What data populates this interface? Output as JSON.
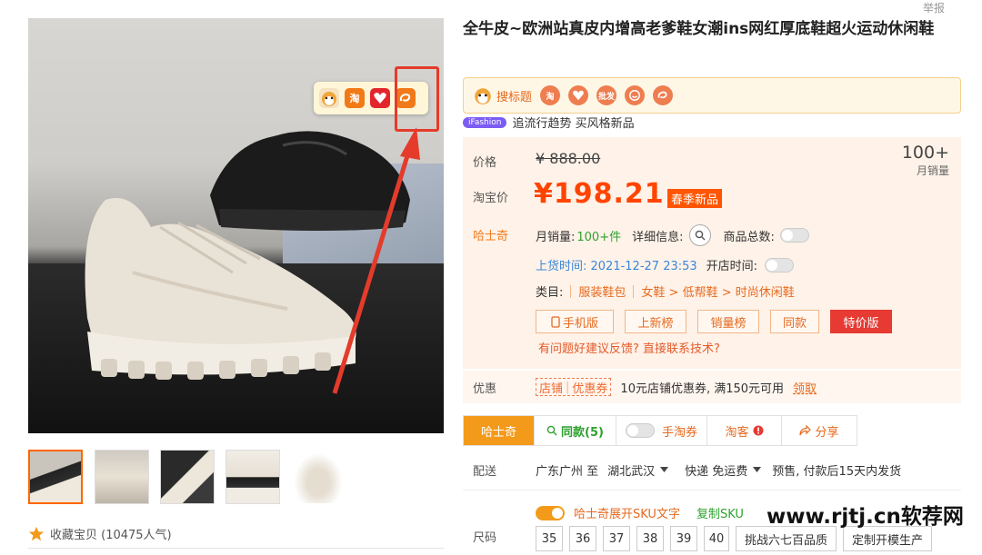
{
  "page_top_text": "举报",
  "product": {
    "title": "全牛皮~欧洲站真皮内增高老爹鞋女潮ins网红厚底鞋超火运动休闲鞋"
  },
  "gallery": {
    "float_icon_labels": [
      "淘"
    ],
    "favorite_text": "收藏宝贝 (10475人气)"
  },
  "plugin_bar": {
    "search_title": "搜标题",
    "icons": [
      {
        "name": "taobao-icon",
        "text": "淘"
      },
      {
        "name": "tmall-love-icon",
        "text": ""
      },
      {
        "name": "wholesale-icon",
        "text": "批发"
      },
      {
        "name": "smile-icon",
        "text": ""
      },
      {
        "name": "alibaba-icon",
        "text": ""
      }
    ]
  },
  "ifashion": {
    "badge": "iFashion",
    "text": "追流行趋势 买风格新品"
  },
  "price_box": {
    "price_label": "价格",
    "original_price": "¥ 888.00",
    "taobao_label": "淘宝价",
    "current_price": "¥198.21",
    "promo_tag": "春季新品",
    "monthly_sales_value": "100+",
    "monthly_sales_label": "月销量",
    "husky_label": "哈士奇",
    "monthly_label": "月销量:",
    "monthly_value": "100+件",
    "detail_info_label": "详细信息:",
    "total_goods_label": "商品总数:",
    "listing_time": "上货时间: 2021-12-27 23:53",
    "store_time_label": "开店时间:",
    "category_label": "类目:",
    "category_main": "服装鞋包",
    "category_path": "女鞋 > 低帮鞋 > 时尚休闲鞋",
    "buttons": [
      "手机版",
      "上新榜",
      "销量榜",
      "同款",
      "特价版"
    ],
    "feedback": "有问题好建议反馈? 直接联系技术?"
  },
  "coupon": {
    "label": "优惠",
    "tag_left": "店铺",
    "tag_right": "优惠券",
    "text": "10元店铺优惠券, 满150元可用",
    "claim": "领取"
  },
  "tabs": {
    "husky": "哈士奇",
    "same": "同款(5)",
    "coupon": "手淘券",
    "taoke": "淘客",
    "share": "分享"
  },
  "shipping": {
    "label": "配送",
    "from": "广东广州 至",
    "to": "湖北武汉",
    "method": "快递 免运费",
    "presale": "预售, 付款后15天内发货"
  },
  "sku": {
    "toggle_text": "哈士奇展开SKU文字",
    "copy_text": "复制SKU",
    "size_label": "尺码",
    "sizes": [
      "35",
      "36",
      "37",
      "38",
      "39",
      "40",
      "挑战六七百品质",
      "定制开模生产"
    ]
  },
  "watermark": {
    "domain": "www.rjtj.cn",
    "name": "软荐网"
  },
  "colors": {
    "accent": "#ff4400",
    "orange": "#f49a1a",
    "red_annotation": "#e43b2b"
  }
}
